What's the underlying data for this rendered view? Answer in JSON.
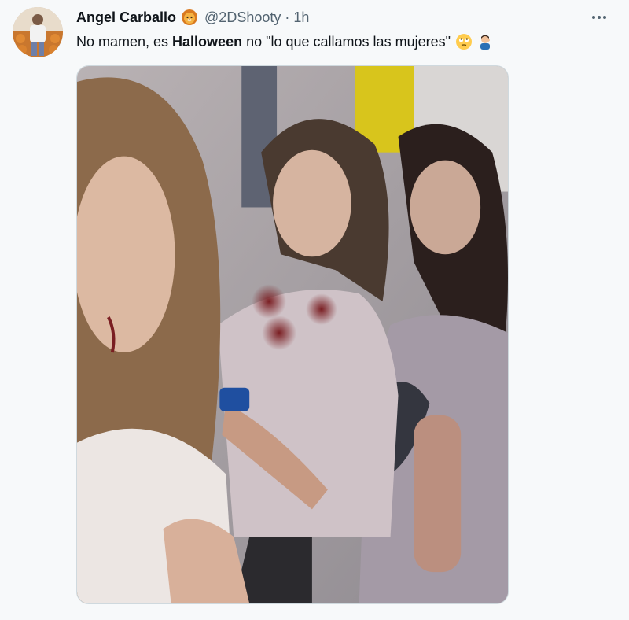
{
  "tweet": {
    "author": {
      "display_name": "Angel Carballo",
      "badge_emoji": "lion-face-emoji",
      "handle": "@2DShooty",
      "separator": "·",
      "time": "1h"
    },
    "text": {
      "part1": "No mamen, es ",
      "bold": "Halloween",
      "part2": " no \"lo que callamos las mujeres\"",
      "emojis": [
        "rolling-eyes-emoji",
        "man-facepalming-emoji"
      ]
    },
    "media": {
      "kind": "photo",
      "alt": "three women in zombie Halloween makeup selfie"
    },
    "more_icon": "more-horizontal-icon"
  },
  "colors": {
    "background": "#f7f9fa",
    "text_primary": "#0f1419",
    "text_secondary": "#536471"
  }
}
